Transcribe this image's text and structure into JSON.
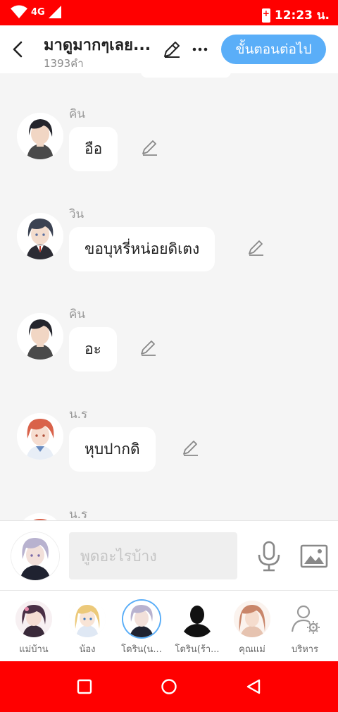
{
  "status_bar": {
    "network": "4G",
    "time": "12:23 น."
  },
  "header": {
    "title": "มาดูมากๆเลย...",
    "word_count": "1393คำ",
    "next_label": "ขั้นตอนต่อไป"
  },
  "messages": [
    {
      "sender": "คิน",
      "text": "อือ",
      "avatar_icon": "avatar-kin"
    },
    {
      "sender": "วิน",
      "text": "ขอบุหรี่หน่อยดิเตง",
      "avatar_icon": "avatar-win"
    },
    {
      "sender": "คิน",
      "text": "อะ",
      "avatar_icon": "avatar-kin"
    },
    {
      "sender": "น.ร",
      "text": "หุบปากดิ",
      "avatar_icon": "avatar-student"
    },
    {
      "sender": "น.ร",
      "text": "",
      "avatar_icon": "avatar-student"
    }
  ],
  "input": {
    "placeholder": "พูดอะไรบ้าง",
    "value": ""
  },
  "characters": [
    {
      "label": "แม่บ้าน",
      "icon": "avatar-maid"
    },
    {
      "label": "น้อง",
      "icon": "avatar-sister"
    },
    {
      "label": "โดริน(น...",
      "icon": "avatar-dorin",
      "selected": true
    },
    {
      "label": "โดริน(ร้า...",
      "icon": "avatar-silhouette"
    },
    {
      "label": "คุณแม่",
      "icon": "avatar-mother"
    },
    {
      "label": "บริหาร",
      "icon": "manage-characters-icon"
    }
  ],
  "colors": {
    "status_bar": "#ff0000",
    "accent": "#5aaef8",
    "chat_background": "#f5f5f5"
  }
}
